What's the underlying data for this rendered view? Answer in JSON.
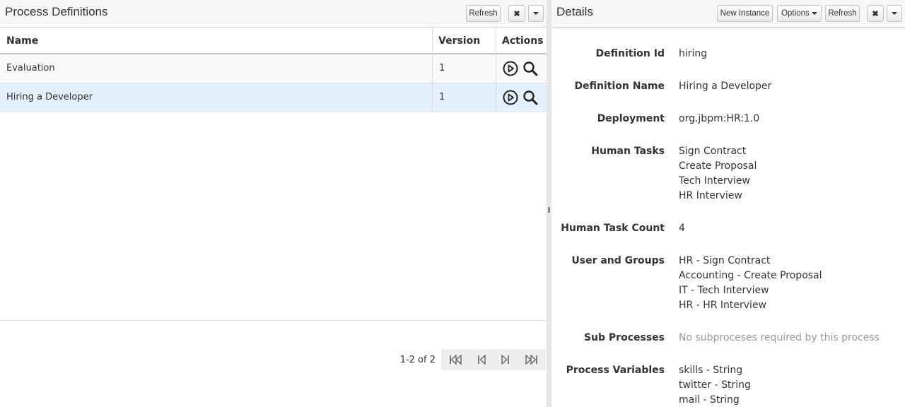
{
  "left": {
    "title": "Process Definitions",
    "refresh_label": "Refresh",
    "columns": [
      "Name",
      "Version",
      "Actions"
    ],
    "rows": [
      {
        "name": "Evaluation",
        "version": "1"
      },
      {
        "name": "Hiring a Developer",
        "version": "1"
      }
    ],
    "pager_label": "1-2 of 2"
  },
  "right": {
    "title": "Details",
    "new_instance_label": "New Instance",
    "options_label": "Options",
    "refresh_label": "Refresh",
    "fields": [
      {
        "label": "Definition Id",
        "values": [
          "hiring"
        ]
      },
      {
        "label": "Definition Name",
        "values": [
          "Hiring a Developer"
        ]
      },
      {
        "label": "Deployment",
        "values": [
          "org.jbpm:HR:1.0"
        ]
      },
      {
        "label": "Human Tasks",
        "values": [
          "Sign Contract",
          "Create Proposal",
          "Tech Interview",
          "HR Interview"
        ]
      },
      {
        "label": "Human Task Count",
        "values": [
          "4"
        ]
      },
      {
        "label": "User and Groups",
        "values": [
          "HR - Sign Contract",
          "Accounting - Create Proposal",
          "IT - Tech Interview",
          "HR - HR Interview"
        ]
      },
      {
        "label": "Sub Processes",
        "values": [
          "No subproceses required by this process"
        ],
        "muted": true
      },
      {
        "label": "Process Variables",
        "values": [
          "skills - String",
          "twitter - String",
          "mail - String"
        ]
      }
    ]
  },
  "colors": {
    "selected_row": "#e3effa",
    "header_bg": "#f7f7f7",
    "muted_text": "#999999"
  }
}
